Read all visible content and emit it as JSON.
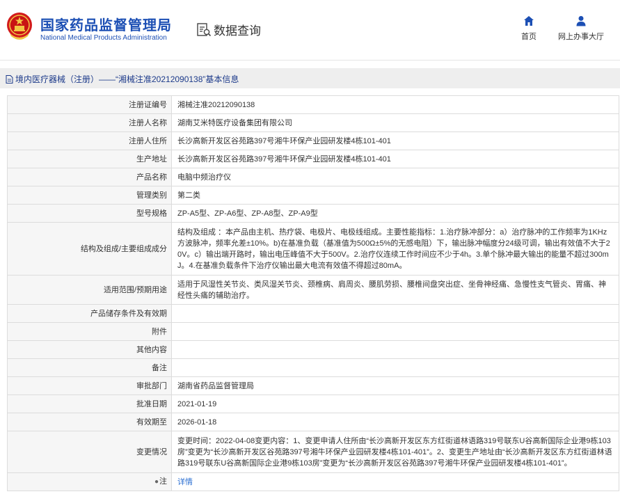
{
  "header": {
    "logo_cn": "国家药品监督管理局",
    "logo_en": "National Medical Products Administration",
    "query_label": "数据查询",
    "nav": {
      "home": "首页",
      "service_hall": "网上办事大厅"
    }
  },
  "breadcrumb": "境内医疗器械（注册）——“湘械注准20212090138”基本信息",
  "rows": [
    {
      "label": "注册证编号",
      "value": "湘械注准20212090138"
    },
    {
      "label": "注册人名称",
      "value": "湖南艾米特医疗设备集团有限公司"
    },
    {
      "label": "注册人住所",
      "value": "长沙高新开发区谷苑路397号湘牛环保产业园研发楼4栋101-401"
    },
    {
      "label": "生产地址",
      "value": "长沙高新开发区谷苑路397号湘牛环保产业园研发楼4栋101-401"
    },
    {
      "label": "产品名称",
      "value": "电脑中频治疗仪"
    },
    {
      "label": "管理类别",
      "value": "第二类"
    },
    {
      "label": "型号规格",
      "value": "ZP-A5型、ZP-A6型、ZP-A8型、ZP-A9型"
    },
    {
      "label": "结构及组成/主要组成成分",
      "value": "结构及组成 ：本产品由主机、热疗袋、电极片、电极线组成。主要性能指标：1.治疗脉冲部分：a）治疗脉冲的工作频率为1KHz方波脉冲，频率允差±10%。b)在基准负载（基准值为500Ω±5%的无感电阻）下，输出脉冲幅度分24级可调，输出有效值不大于20V。c）输出端开路时，输出电压峰值不大于500V。2.治疗仪连续工作时间应不少于4h。3.单个脉冲最大输出的能量不超过300mJ。4.在基准负载条件下治疗仪输出最大电流有效值不得超过80mA。"
    },
    {
      "label": "适用范围/预期用途",
      "value": "适用于风湿性关节炎、类风湿关节炎、颈椎病、肩周炎、腰肌劳损、腰椎间盘突出症、坐骨神经痛、急慢性支气管炎、胃痛、神经性头痛的辅助治疗。"
    },
    {
      "label": "产品储存条件及有效期",
      "value": ""
    },
    {
      "label": "附件",
      "value": ""
    },
    {
      "label": "其他内容",
      "value": ""
    },
    {
      "label": "备注",
      "value": ""
    },
    {
      "label": "审批部门",
      "value": "湖南省药品监督管理局"
    },
    {
      "label": "批准日期",
      "value": "2021-01-19"
    },
    {
      "label": "有效期至",
      "value": "2026-01-18"
    },
    {
      "label": "变更情况",
      "value": "变更时间：2022-04-08变更内容：1、变更申请人住所由“长沙高新开发区东方红街道林语路319号联东U谷高新国际企业港9栋103房”变更为“长沙高新开发区谷苑路397号湘牛环保产业园研发楼4栋101-401”。2、变更生产地址由“长沙高新开发区东方红街道林语路319号联东U谷高新国际企业港9栋103房”变更为“长沙高新开发区谷苑路397号湘牛环保产业园研发楼4栋101-401”。"
    }
  ],
  "note": {
    "label": "注",
    "link": "详情"
  }
}
